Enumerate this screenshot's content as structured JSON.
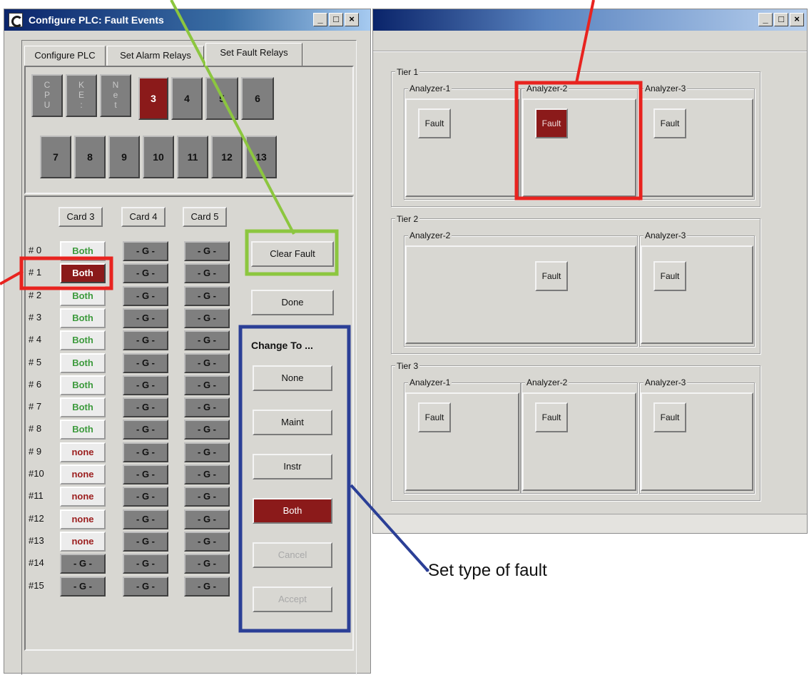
{
  "left_window": {
    "title": "Configure PLC:  Fault Events",
    "controls": {
      "minimize": "_",
      "maximize": "□",
      "close": "×"
    },
    "tabs": [
      {
        "label": "Configure PLC"
      },
      {
        "label": "Set Alarm Relays"
      },
      {
        "label": "Set Fault Relays"
      }
    ],
    "card_buttons_row1": [
      {
        "label": "C\nP\nU"
      },
      {
        "label": "K\nE\n:"
      },
      {
        "label": "N\ne\nt"
      },
      {
        "label": "3"
      },
      {
        "label": "4"
      },
      {
        "label": "5"
      },
      {
        "label": "6"
      }
    ],
    "card_buttons_row2": [
      {
        "label": "7"
      },
      {
        "label": "8"
      },
      {
        "label": "9"
      },
      {
        "label": "10"
      },
      {
        "label": "11"
      },
      {
        "label": "12"
      },
      {
        "label": "13"
      }
    ],
    "columns": [
      "Card 3",
      "Card 4",
      "Card 5"
    ],
    "rows": [
      {
        "label": "# 0",
        "card3": "Both",
        "card4": "- G -",
        "card5": "- G -"
      },
      {
        "label": "# 1",
        "card3": "Both",
        "card4": "- G -",
        "card5": "- G -"
      },
      {
        "label": "# 2",
        "card3": "Both",
        "card4": "- G -",
        "card5": "- G -"
      },
      {
        "label": "# 3",
        "card3": "Both",
        "card4": "- G -",
        "card5": "- G -"
      },
      {
        "label": "# 4",
        "card3": "Both",
        "card4": "- G -",
        "card5": "- G -"
      },
      {
        "label": "# 5",
        "card3": "Both",
        "card4": "- G -",
        "card5": "- G -"
      },
      {
        "label": "# 6",
        "card3": "Both",
        "card4": "- G -",
        "card5": "- G -"
      },
      {
        "label": "# 7",
        "card3": "Both",
        "card4": "- G -",
        "card5": "- G -"
      },
      {
        "label": "# 8",
        "card3": "Both",
        "card4": "- G -",
        "card5": "- G -"
      },
      {
        "label": "# 9",
        "card3": "none",
        "card4": "- G -",
        "card5": "- G -"
      },
      {
        "label": "#10",
        "card3": "none",
        "card4": "- G -",
        "card5": "- G -"
      },
      {
        "label": "#11",
        "card3": "none",
        "card4": "- G -",
        "card5": "- G -"
      },
      {
        "label": "#12",
        "card3": "none",
        "card4": "- G -",
        "card5": "- G -"
      },
      {
        "label": "#13",
        "card3": "none",
        "card4": "- G -",
        "card5": "- G -"
      },
      {
        "label": "#14",
        "card3": "- G -",
        "card4": "- G -",
        "card5": "- G -"
      },
      {
        "label": "#15",
        "card3": "- G -",
        "card4": "- G -",
        "card5": "- G -"
      }
    ],
    "buttons": {
      "clear_fault": "Clear Fault",
      "done": "Done",
      "change_to_title": "Change To ...",
      "none": "None",
      "maint": "Maint",
      "instr": "Instr",
      "both": "Both",
      "cancel": "Cancel",
      "accept": "Accept"
    }
  },
  "right_window": {
    "controls": {
      "minimize": "_",
      "maximize": "□",
      "close": "×"
    },
    "tiers": [
      {
        "label": "Tier 1",
        "analyzers": [
          {
            "label": "Analyzer-1",
            "fault": "Fault"
          },
          {
            "label": "Analyzer-2",
            "fault": "Fault"
          },
          {
            "label": "Analyzer-3",
            "fault": "Fault"
          }
        ]
      },
      {
        "label": "Tier 2",
        "analyzers": [
          {
            "label": "Analyzer-2",
            "fault": "Fault"
          },
          {
            "label": "Analyzer-3",
            "fault": "Fault"
          }
        ]
      },
      {
        "label": "Tier 3",
        "analyzers": [
          {
            "label": "Analyzer-1",
            "fault": "Fault"
          },
          {
            "label": "Analyzer-2",
            "fault": "Fault"
          },
          {
            "label": "Analyzer-3",
            "fault": "Fault"
          }
        ]
      }
    ]
  },
  "annotations": {
    "set_type_of_fault": "Set type of fault"
  },
  "colors": {
    "fault_active": "#8b1a1a",
    "both_text": "#3c9a3c",
    "none_text": "#9b1d1d",
    "callout_red": "#e8231f",
    "callout_green": "#8cc63f",
    "callout_blue": "#2b3f96"
  }
}
